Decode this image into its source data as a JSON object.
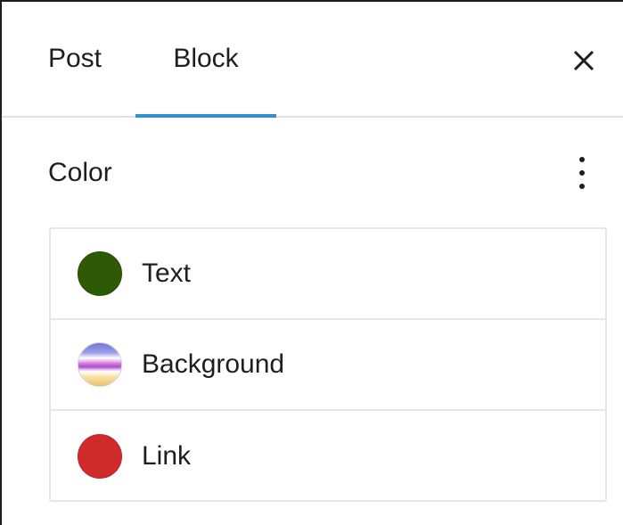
{
  "tabs": [
    {
      "label": "Post",
      "active": false
    },
    {
      "label": "Block",
      "active": true
    }
  ],
  "header": {
    "close_icon": "close-icon",
    "accent_color": "#2f8fd0"
  },
  "color_panel": {
    "title": "Color",
    "options_icon": "more-vertical-icon",
    "items": [
      {
        "label": "Text",
        "swatch": "#2e5a05"
      },
      {
        "label": "Background",
        "swatch": "gradient"
      },
      {
        "label": "Link",
        "swatch": "#cf2b2b"
      }
    ]
  }
}
